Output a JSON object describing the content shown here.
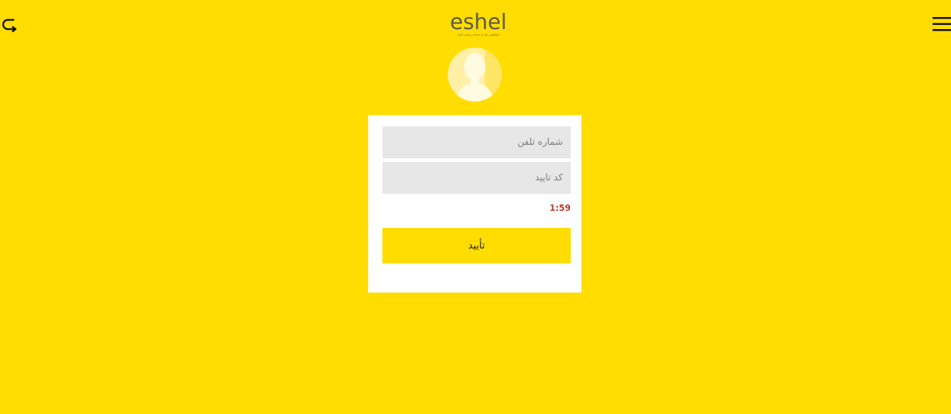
{
  "header": {
    "logo_text": "eshel",
    "logo_tagline": "اپلیکیشن پیک و خدمات رسانی اشل",
    "back_icon": "back-arrow-icon",
    "menu_icon": "hamburger-menu-icon"
  },
  "avatar": {
    "icon": "user-avatar-icon"
  },
  "form": {
    "phone_placeholder": "شماره تلفن",
    "phone_value": "",
    "code_placeholder": "کد تایید",
    "code_value": "",
    "timer": "1:59",
    "submit_label": "تأیید"
  },
  "colors": {
    "background": "#ffdd00",
    "card": "#ffffff",
    "input_bg": "#e7e7e7",
    "button_bg": "#ffdd00",
    "timer_text": "#c0392b",
    "logo_text": "#5c5a4e"
  }
}
